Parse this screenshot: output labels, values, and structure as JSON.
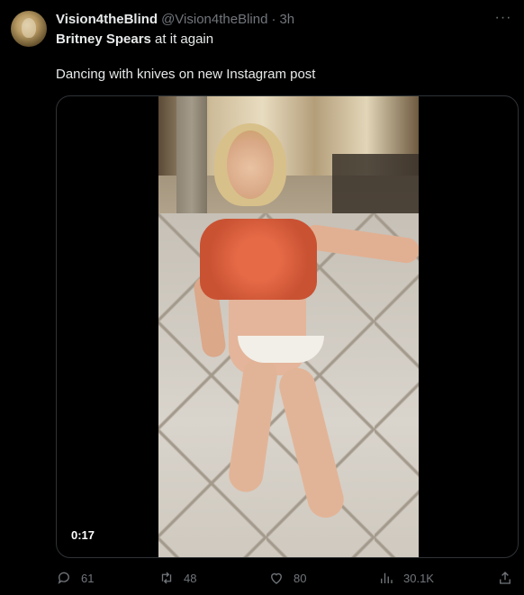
{
  "tweet": {
    "display_name": "Vision4theBlind",
    "handle": "@Vision4theBlind",
    "separator": "·",
    "time": "3h",
    "more_label": "···",
    "line1_bold": "Britney Spears",
    "line1_rest": " at it again",
    "line2": "Dancing with knives on new Instagram post"
  },
  "media": {
    "duration": "0:17"
  },
  "actions": {
    "replies": "61",
    "retweets": "48",
    "likes": "80",
    "views": "30.1K"
  },
  "icons": {
    "reply": "reply-icon",
    "retweet": "retweet-icon",
    "like": "heart-icon",
    "views": "views-icon",
    "share": "share-icon",
    "more": "more-icon"
  },
  "colors": {
    "background": "#000000",
    "text": "#e7e9ea",
    "secondary": "#71767b",
    "border": "#2f3336"
  }
}
